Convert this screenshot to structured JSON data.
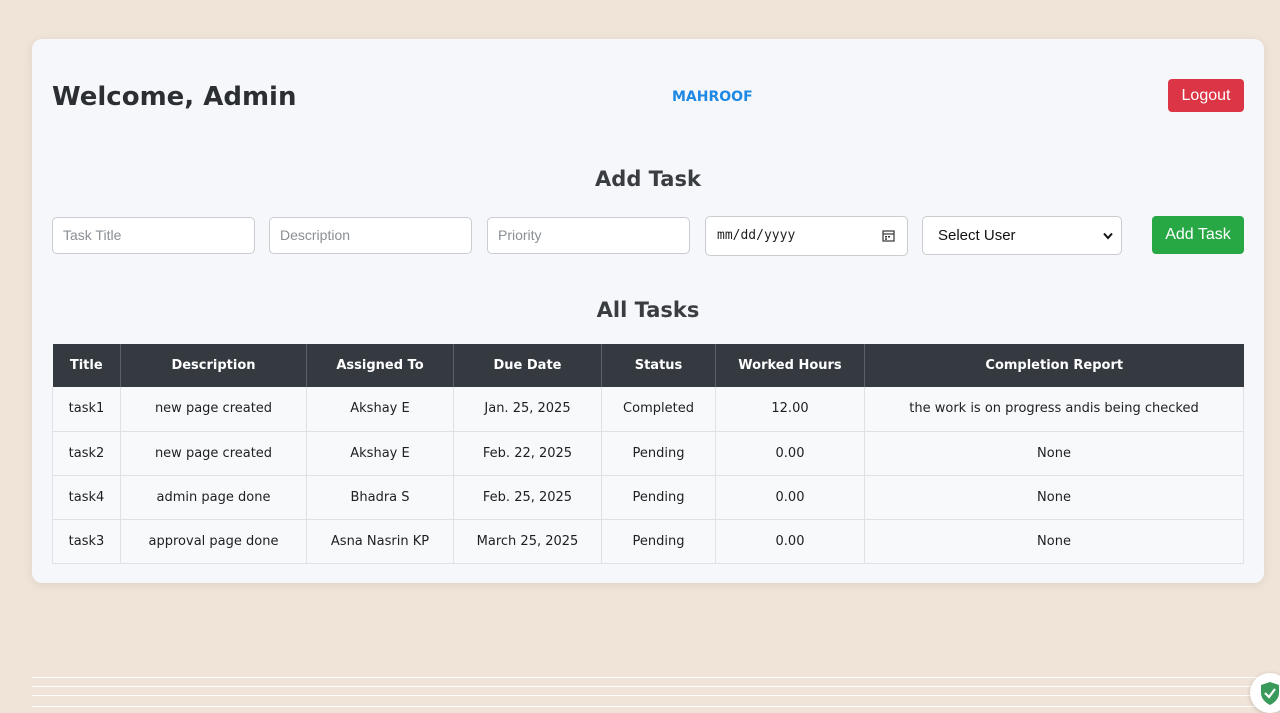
{
  "header": {
    "welcome": "Welcome, Admin",
    "brand": "MAHROOF",
    "logout_label": "Logout"
  },
  "add_task": {
    "title": "Add Task",
    "task_title_placeholder": "Task Title",
    "description_placeholder": "Description",
    "priority_placeholder": "Priority",
    "date_placeholder": "mm/dd/yyyy",
    "select_user_label": "Select User",
    "button_label": "Add Task"
  },
  "tasks": {
    "title": "All Tasks",
    "columns": [
      "Title",
      "Description",
      "Assigned To",
      "Due Date",
      "Status",
      "Worked Hours",
      "Completion Report"
    ],
    "rows": [
      [
        "task1",
        "new page created",
        "Akshay E",
        "Jan. 25, 2025",
        "Completed",
        "12.00",
        "the work is on progress andis being checked"
      ],
      [
        "task2",
        "new page created",
        "Akshay E",
        "Feb. 22, 2025",
        "Pending",
        "0.00",
        "None"
      ],
      [
        "task4",
        "admin page done",
        "Bhadra S",
        "Feb. 25, 2025",
        "Pending",
        "0.00",
        "None"
      ],
      [
        "task3",
        "approval page done",
        "Asna Nasrin KP",
        "March 25, 2025",
        "Pending",
        "0.00",
        "None"
      ]
    ]
  },
  "colors": {
    "logout": "#dc3545",
    "add_button": "#28a745",
    "brand": "#1e88e5",
    "table_header": "#343a40"
  },
  "icons": [
    "calendar-icon",
    "chevron-down-icon",
    "shield-icon"
  ]
}
